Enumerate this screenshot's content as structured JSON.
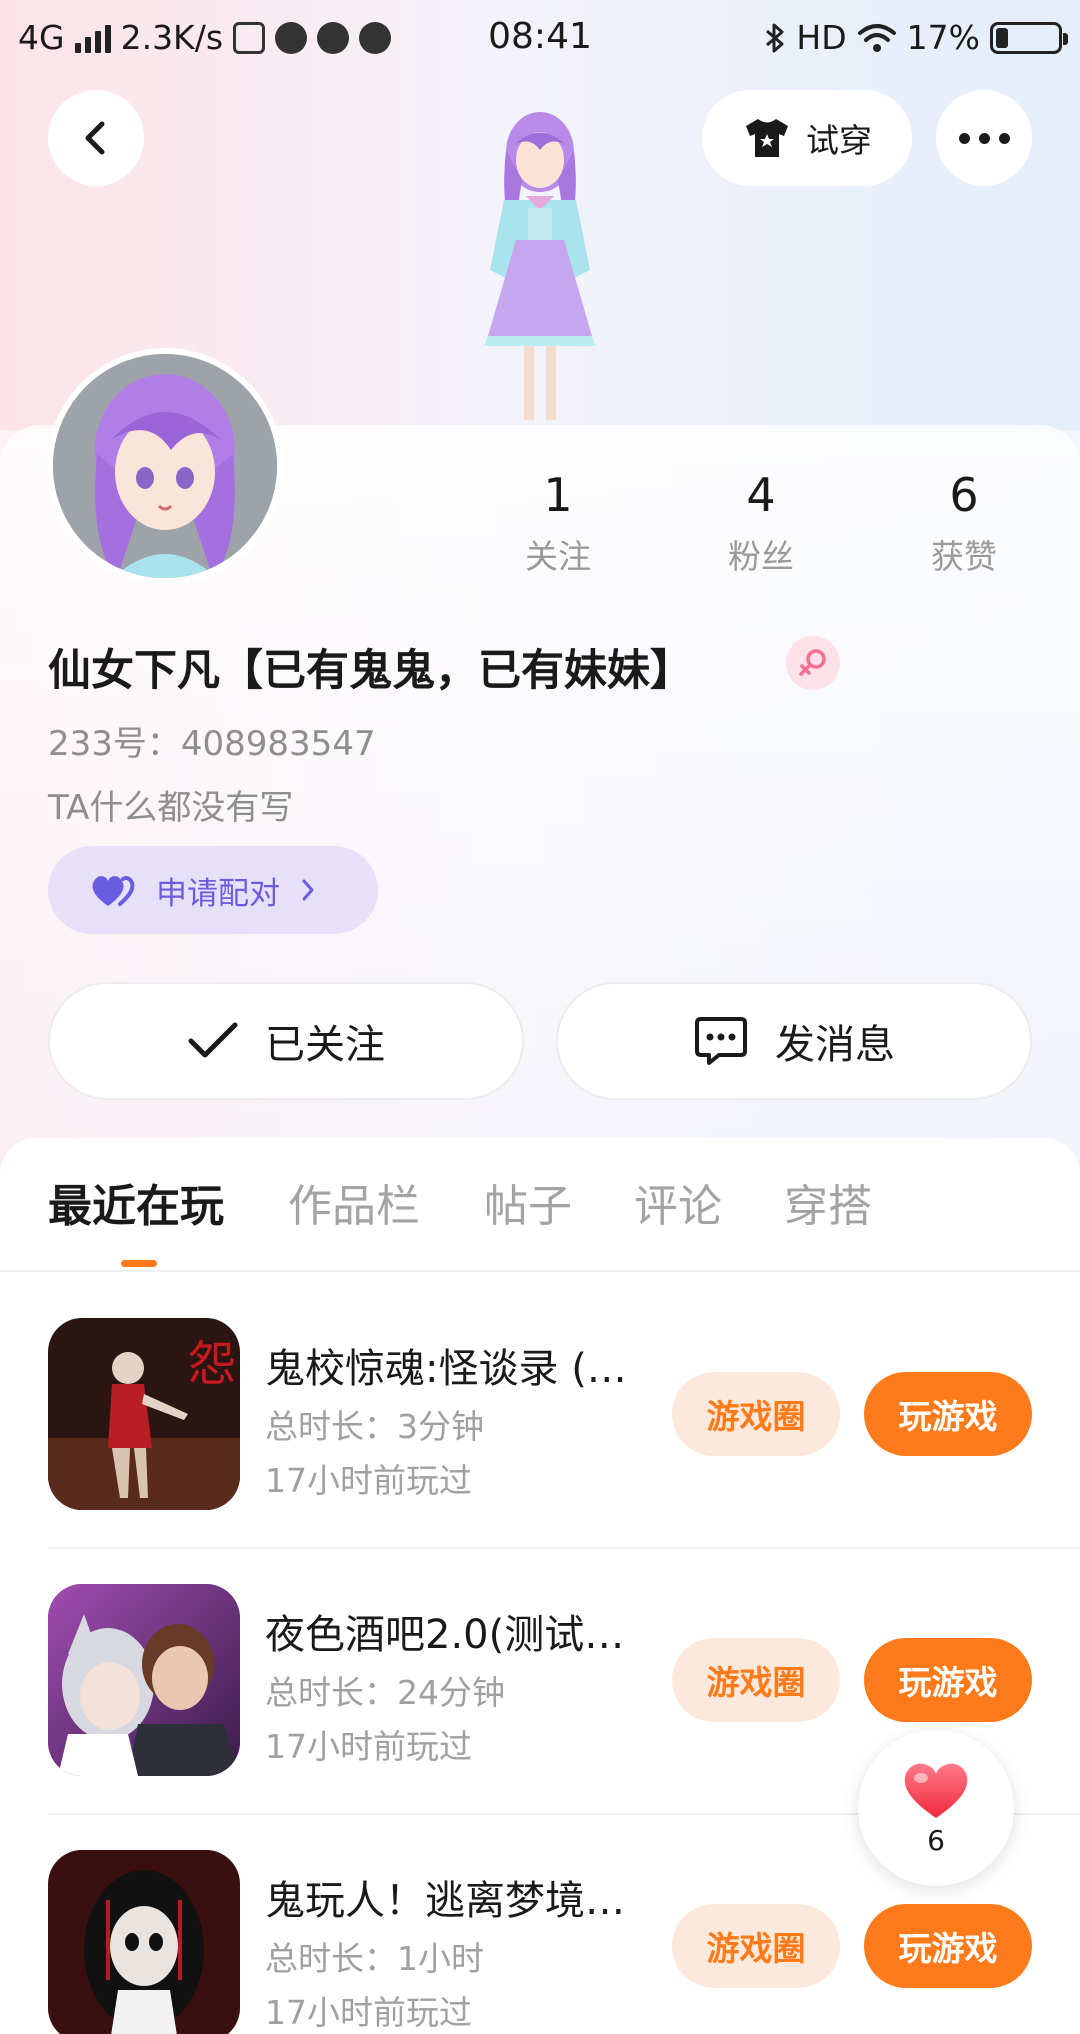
{
  "status_bar": {
    "network": "4G",
    "speed": "2.3K/s",
    "time": "08:41",
    "hd": "HD",
    "battery": "17%"
  },
  "header": {
    "tryon_label": "试穿"
  },
  "profile": {
    "stats": [
      {
        "value": "1",
        "label": "关注"
      },
      {
        "value": "4",
        "label": "粉丝"
      },
      {
        "value": "6",
        "label": "获赞"
      }
    ],
    "nickname": "仙女下凡【已有鬼鬼，已有妹妹】",
    "id_text": "233号：408983547",
    "bio": "TA什么都没有写",
    "pair_label": "申请配对",
    "followed_label": "已关注",
    "message_label": "发消息"
  },
  "tabs": [
    {
      "label": "最近在玩",
      "active": true
    },
    {
      "label": "作品栏",
      "active": false
    },
    {
      "label": "帖子",
      "active": false
    },
    {
      "label": "评论",
      "active": false
    },
    {
      "label": "穿搭",
      "active": false
    }
  ],
  "games": [
    {
      "title": "鬼校惊魂:怪谈录 (…",
      "duration": "总时长：3分钟",
      "last_played": "17小时前玩过",
      "circle_label": "游戏圈",
      "play_label": "玩游戏"
    },
    {
      "title": "夜色酒吧2.0(测试…",
      "duration": "总时长：24分钟",
      "last_played": "17小时前玩过",
      "circle_label": "游戏圈",
      "play_label": "玩游戏"
    },
    {
      "title": "鬼玩人！逃离梦境…",
      "duration": "总时长：1小时",
      "last_played": "17小时前玩过",
      "circle_label": "游戏圈",
      "play_label": "玩游戏"
    }
  ],
  "like_float": {
    "count": "6"
  },
  "colors": {
    "accent": "#ff7a1a",
    "accent_soft": "#fde9dc",
    "pair_bg": "#e6e1f8",
    "pair_text": "#6b5ce0"
  }
}
